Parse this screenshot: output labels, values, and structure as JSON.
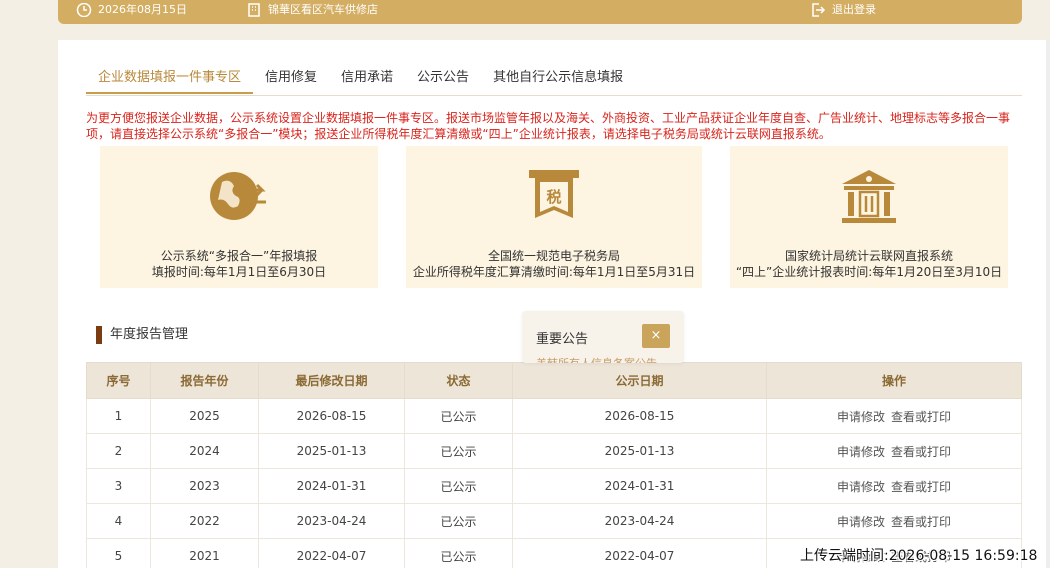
{
  "topbar": {
    "date": "2026年08月15日",
    "location": "锦華区看区汽车供修店",
    "logout": "退出登录"
  },
  "tabs": [
    {
      "label": "企业数据填报一件事专区",
      "active": true
    },
    {
      "label": "信用修复",
      "active": false
    },
    {
      "label": "信用承诺",
      "active": false
    },
    {
      "label": "公示公告",
      "active": false
    },
    {
      "label": "其他自行公示信息填报",
      "active": false
    }
  ],
  "notice": "为更方便您报送企业数据，公示系统设置企业数据填报一件事专区。报送市场监管年报以及海关、外商投资、工业产品获证企业年度自查、广告业统计、地理标志等多报合一事项，请直接选择公示系统“多报合一”模块；报送企业所得税年度汇算清缴或“四上”企业统计报表，请选择电子税务局或统计云联网直报系统。",
  "cards": [
    {
      "icon": "globe-arrows-icon",
      "line1": "公示系统“多报合一”年报填报",
      "line2": "填报时间:每年1月1日至6月30日"
    },
    {
      "icon": "tax-icon",
      "icon_text": "税",
      "line1": "全国统一规范电子税务局",
      "line2": "企业所得税年度汇算清缴时间:每年1月1日至5月31日"
    },
    {
      "icon": "bank-building-icon",
      "line1": "国家统计局统计云联网直报系统",
      "line2": "“四上”企业统计报表时间:每年1月20日至3月10日"
    }
  ],
  "section_title": "年度报告管理",
  "popup": {
    "title": "重要公告",
    "close": "×",
    "sub": "盖韩所有人信息各案公告"
  },
  "table": {
    "headers": [
      "序号",
      "报告年份",
      "最后修改日期",
      "状态",
      "公示日期",
      "操作"
    ],
    "rows": [
      {
        "no": "1",
        "year": "2025",
        "modified": "2026-08-15",
        "status": "已公示",
        "published": "2026-08-15",
        "act1": "申请修改",
        "act2": "查看或打印"
      },
      {
        "no": "2",
        "year": "2024",
        "modified": "2025-01-13",
        "status": "已公示",
        "published": "2025-01-13",
        "act1": "申请修改",
        "act2": "查看或打印"
      },
      {
        "no": "3",
        "year": "2023",
        "modified": "2024-01-31",
        "status": "已公示",
        "published": "2024-01-31",
        "act1": "申请修改",
        "act2": "查看或打印"
      },
      {
        "no": "4",
        "year": "2022",
        "modified": "2023-04-24",
        "status": "已公示",
        "published": "2023-04-24",
        "act1": "申请修改",
        "act2": "查看或打印"
      },
      {
        "no": "5",
        "year": "2021",
        "modified": "2022-04-07",
        "status": "已公示",
        "published": "2022-04-07",
        "act1": "申请修改",
        "act2": "查看或打印"
      }
    ]
  },
  "watermark": "上传云端时间:2026-08-15 16:59:18",
  "colors": {
    "accent": "#d3ae62",
    "tab_active": "#b8893a",
    "notice": "#d9241c",
    "card_bg": "#fdf4e1"
  }
}
